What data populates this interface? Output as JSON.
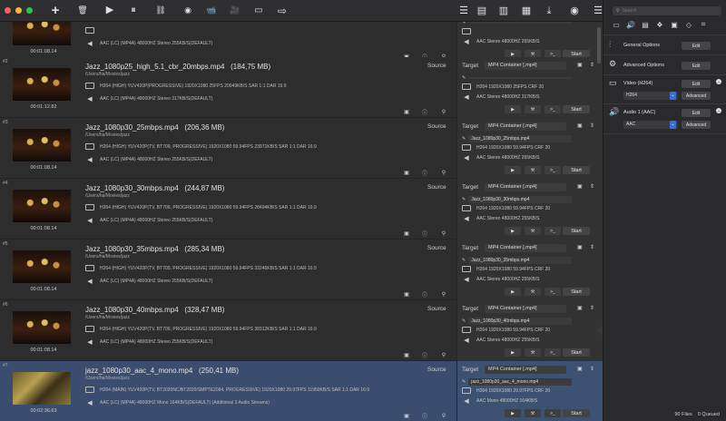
{
  "colors": {
    "accent": "#3a6fd8",
    "selected_row": "#3a4d6e",
    "traffic_red": "#fd5f57",
    "traffic_yellow": "#febc2e",
    "traffic_green": "#28c840"
  },
  "toolbar": {
    "icons": [
      "add-icon",
      "trash-icon",
      "play-icon",
      "pause-icon",
      "link-icon",
      "circle-icon",
      "camera-icon",
      "camera-alt-icon",
      "video-icon",
      "export-icon",
      "list-icon",
      "list-alt-icon",
      "grid-icon",
      "table-icon",
      "download-icon",
      "eye-icon"
    ],
    "glyphs": {
      "add": "+",
      "trash": "🗑",
      "play": "▶",
      "pause": "⏸",
      "link": "⛓",
      "circle": "◉",
      "cam1": "📹",
      "cam2": "🎥",
      "cam3": "▭",
      "export": "⇨",
      "list1": "☰",
      "list2": "▤",
      "grid": "▥",
      "table": "▦",
      "dl": "⤓",
      "eye": "◉",
      "menu": "☰"
    }
  },
  "labels": {
    "source": "Source",
    "target": "Target",
    "start": "Start"
  },
  "jobs": [
    {
      "num": "",
      "name": "",
      "path": "",
      "video": "",
      "audio": "AAC (LC) (MP4A) 48000HZ Stereo 255KB/S(DEFAULT)",
      "duration": "00:01:08.14",
      "target_name": "",
      "target_video": "",
      "target_audio": "AAC Stereo 48000HZ 255KB/S",
      "container": "",
      "thumb": "dark",
      "selected": false
    },
    {
      "num": "#2",
      "name": "Jazz_1080p25_high_5.1_cbr_20mbps.mp4",
      "size": "(184,75 MB)",
      "path": "/Users/ha/Movies/jazz",
      "video": "H264 (HIGH) YUV420P(PROGRESSIVE) 1920X1080 25FPS 20049KB/S SAR 1:1 DAR 16:9",
      "audio": "AAC (LC) (MP4A) 48000HZ Stereo 317KB/S(DEFAULT)",
      "duration": "00:01:12.82",
      "target_name": "",
      "target_video": "H264 1920X1080 25FPS CRF 20",
      "target_audio": "AAC Stereo 48000HZ 317KB/S",
      "container": "MP4 Container [.mp4]",
      "thumb": "dark",
      "selected": false
    },
    {
      "num": "#3",
      "name": "Jazz_1080p30_25mbps.mp4",
      "size": "(206,36 MB)",
      "path": "/Users/ha/Movies/jazz",
      "video": "H264 (HIGH) YUV420P(TV, BT709, PROGRESSIVE) 1920X1080 59.94FPS 23971KB/S SAR 1:1 DAR 16:9",
      "audio": "AAC (LC) (MP4A) 48000HZ Stereo 255KB/S(DEFAULT)",
      "duration": "00:01:08.14",
      "target_name": "Jazz_1080p30_25mbps.mp4",
      "target_video": "H264 1920X1080 59.94FPS CRF 20",
      "target_audio": "AAC Stereo 48000HZ 255KB/S",
      "container": "MP4 Container [.mp4]",
      "thumb": "dark",
      "selected": false
    },
    {
      "num": "#4",
      "name": "Jazz_1080p30_30mbps.mp4",
      "size": "(244,87 MB)",
      "path": "/Users/ha/Movies/jazz",
      "video": "H264 (HIGH) YUV420P(TV, BT709, PROGRESSIVE) 1920X1080 59.94FPS 28494KB/S SAR 1:1 DAR 16:9",
      "audio": "AAC (LC) (MP4A) 48000HZ Stereo 255KB/S(DEFAULT)",
      "duration": "00:01:08.14",
      "target_name": "Jazz_1080p30_30mbps.mp4",
      "target_video": "H264 1920X1080 59.94FPS CRF 20",
      "target_audio": "AAC Stereo 48000HZ 255KB/S",
      "container": "MP4 Container [.mp4]",
      "thumb": "dark",
      "selected": false
    },
    {
      "num": "#5",
      "name": "Jazz_1080p30_35mbps.mp4",
      "size": "(285,34 MB)",
      "path": "/Users/ha/Movies/jazz",
      "video": "H264 (HIGH) YUV420P(TV, BT709, PROGRESSIVE) 1920X1080 59.94FPS 33246KB/S SAR 1:1 DAR 16:9",
      "audio": "AAC (LC) (MP4A) 48000HZ Stereo 255KB/S(DEFAULT)",
      "duration": "00:01:08.14",
      "target_name": "Jazz_1080p30_35mbps.mp4",
      "target_video": "H264 1920X1080 59.94FPS CRF 20",
      "target_audio": "AAC Stereo 48000HZ 255KB/S",
      "container": "MP4 Container [.mp4]",
      "thumb": "dark",
      "selected": false
    },
    {
      "num": "#6",
      "name": "Jazz_1080p30_40mbps.mp4",
      "size": "(328,47 MB)",
      "path": "/Users/ha/Movies/jazz",
      "video": "H264 (HIGH) YUV420P(TV, BT709, PROGRESSIVE) 1920X1080 59.94FPS 38312KB/S SAR 1:1 DAR 16:9",
      "audio": "AAC (LC) (MP4A) 48000HZ Stereo 255KB/S(DEFAULT)",
      "duration": "00:01:08.14",
      "target_name": "Jazz_1080p30_40mbps.mp4",
      "target_video": "H264 1920X1080 59.94FPS CRF 20",
      "target_audio": "AAC Stereo 48000HZ 255KB/S",
      "container": "MP4 Container [.mp4]",
      "thumb": "dark",
      "selected": false
    },
    {
      "num": "#7",
      "name": "jazz_1080p30_aac_4_mono.mp4",
      "size": "(250,41 MB)",
      "path": "/Users/ha/Movies/jazz",
      "video": "H264 (MAIN) YUV420P(TV, BT2020NC/BT2020/SMPTE2084, PROGRESSIVE) 1920X1080 29.97FPS 11950KB/S SAR 1:1 DAR 16:9",
      "audio": "AAC (LC) (MP4A) 48000HZ Mono 164KB/S(DEFAULT) (Additional 3 Audio Streams)",
      "duration": "00:02:36.63",
      "target_name": "jazz_1080p30_aac_4_mono.mp4",
      "target_video": "H264 1920X1080 29.97FPS CRF 20",
      "target_audio": "AAC Mono 48000HZ 164KB/S",
      "container": "MP4 Container [.mp4]",
      "thumb": "bright",
      "selected": true
    }
  ],
  "sidebar": {
    "search": {
      "placeholder": "Search",
      "value": ""
    },
    "icons": [
      "video-settings-icon",
      "audio-settings-icon",
      "subtitle-icon",
      "package-icon",
      "chip-icon",
      "tag-icon",
      "crop-icon"
    ],
    "general": {
      "label": "General Options",
      "edit": "Edit"
    },
    "advanced": {
      "label": "Advanced Options",
      "edit": "Edit"
    },
    "video": {
      "label": "Video (H264)",
      "edit": "Edit",
      "codec": "H264",
      "advanced": "Advanced"
    },
    "audio": {
      "label": "Audio 1 (AAC)",
      "edit": "Edit",
      "codec": "AAC",
      "advanced": "Advanced"
    },
    "status": {
      "files": "90 Files",
      "queued": "0 Queued"
    }
  }
}
